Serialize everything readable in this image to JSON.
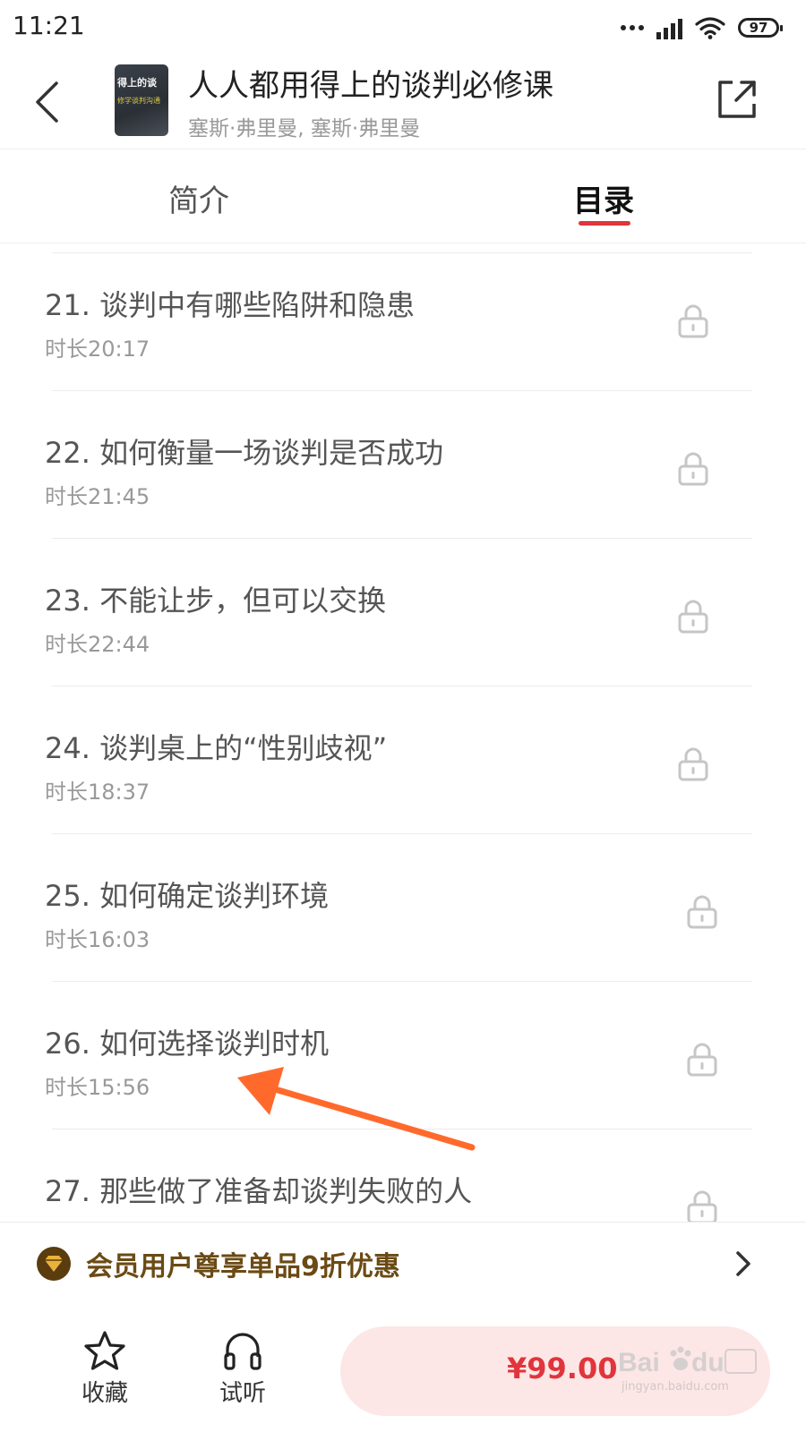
{
  "status_bar": {
    "time": "11:21",
    "battery": "97"
  },
  "header": {
    "title": "人人都用得上的谈判必修课",
    "author": "塞斯·弗里曼, 塞斯·弗里曼",
    "cover_title": "得上的谈",
    "cover_subtitle": "修学谈判沟通"
  },
  "tabs": [
    {
      "label": "简介",
      "active": false
    },
    {
      "label": "目录",
      "active": true
    }
  ],
  "chapters": [
    {
      "title": "21. 谈判中有哪些陷阱和隐患",
      "duration": "时长20:17",
      "locked": true
    },
    {
      "title": "22. 如何衡量一场谈判是否成功",
      "duration": "时长21:45",
      "locked": true
    },
    {
      "title": "23. 不能让步，但可以交换",
      "duration": "时长22:44",
      "locked": true
    },
    {
      "title": "24. 谈判桌上的“性别歧视”",
      "duration": "时长18:37",
      "locked": true
    },
    {
      "title": "25. 如何确定谈判环境",
      "duration": "时长16:03",
      "locked": true
    },
    {
      "title": "26. 如何选择谈判时机",
      "duration": "时长15:56",
      "locked": true
    },
    {
      "title": "27. 那些做了准备却谈判失败的人",
      "duration": "",
      "locked": true
    }
  ],
  "member_banner": {
    "text": "会员用户尊享单品9折优惠"
  },
  "bottom_bar": {
    "favorite_label": "收藏",
    "preview_label": "试听",
    "price": "¥99.00"
  },
  "watermark": {
    "url": "jingyan.baidu.com"
  },
  "colors": {
    "accent": "#e0353c",
    "buy_bg": "#fde6e6",
    "member_text": "#6b4a14",
    "vip_gold": "#e9b23a",
    "annotation": "#ff6a2c"
  },
  "icons": [
    "back-arrow-icon",
    "share-icon",
    "lock-icon",
    "vip-diamond-icon",
    "chevron-right-icon",
    "star-icon",
    "headphones-icon"
  ]
}
